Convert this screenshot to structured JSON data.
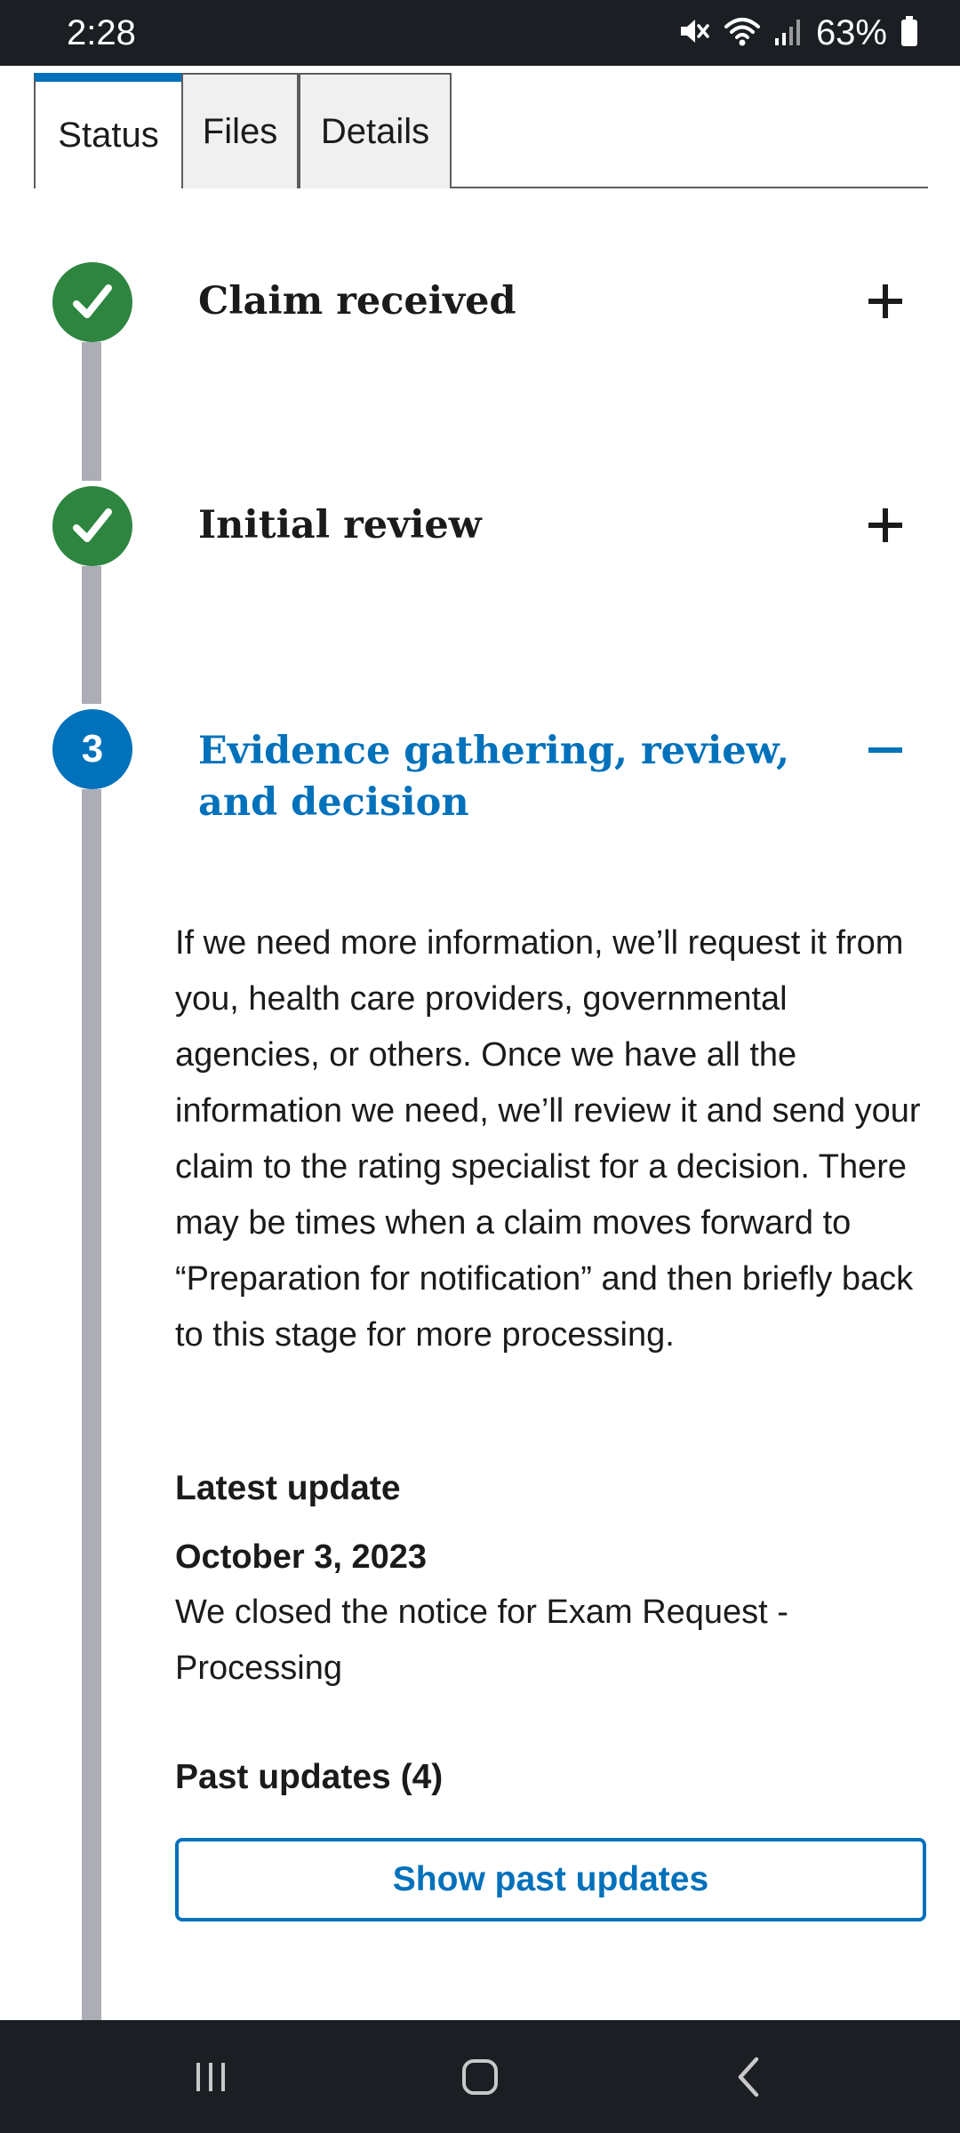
{
  "status_bar": {
    "time": "2:28",
    "battery_pct": "63%",
    "icons": [
      "mute-icon",
      "wifi-icon",
      "signal-icon",
      "battery-icon"
    ]
  },
  "tabs": [
    {
      "label": "Status",
      "active": true
    },
    {
      "label": "Files",
      "active": false
    },
    {
      "label": "Details",
      "active": false
    }
  ],
  "steps": [
    {
      "title": "Claim received",
      "state": "complete",
      "expanded": false
    },
    {
      "title": "Initial review",
      "state": "complete",
      "expanded": false
    },
    {
      "number": "3",
      "title": "Evidence gathering, review, and decision",
      "state": "current",
      "expanded": true
    }
  ],
  "current_step": {
    "description": "If we need more information, we’ll request it from you, health care providers, governmental agencies, or others. Once we have all the information we need, we’ll review it and send your claim to the rating specialist for a decision. There may be times when a claim moves forward to “Preparation for notification” and then briefly back to this stage for more processing.",
    "latest_update_heading": "Latest update",
    "latest_update_date": "October 3, 2023",
    "latest_update_text": "We closed the notice for Exam Request - Processing",
    "past_updates_heading": "Past updates (4)",
    "show_past_button": "Show past updates"
  },
  "colors": {
    "accent": "#0071bb",
    "complete": "#2e8540",
    "timeline": "#adadb5",
    "system_bar": "#1b1e22"
  },
  "nav_bar": {
    "icons": [
      "recent-apps-icon",
      "home-icon",
      "back-icon"
    ]
  }
}
